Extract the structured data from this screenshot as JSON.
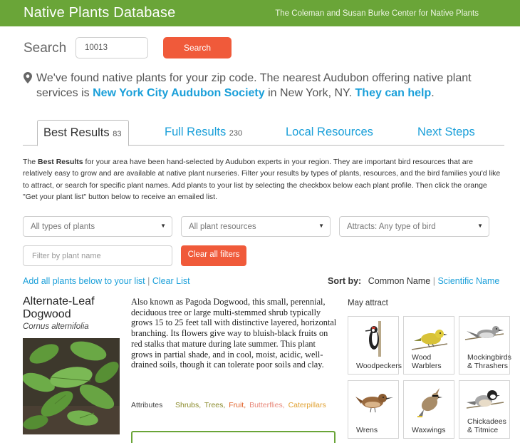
{
  "header": {
    "title": "Native Plants Database",
    "subtitle": "The Coleman and Susan Burke Center for Native Plants"
  },
  "search": {
    "label": "Search",
    "value": "10013",
    "button": "Search"
  },
  "notice": {
    "pre": "We've found native plants for your zip code. The nearest Audubon offering native plant services is ",
    "society": "New York City Audubon Society",
    "mid": " in New York, NY. ",
    "help": "They can help",
    "post": "."
  },
  "tabs": [
    {
      "label": "Best Results",
      "count": "83"
    },
    {
      "label": "Full Results",
      "count": "230"
    },
    {
      "label": "Local Resources",
      "count": ""
    },
    {
      "label": "Next Steps",
      "count": ""
    }
  ],
  "description": {
    "pre": "The ",
    "bold": "Best Results",
    "post": " for your area have been hand-selected by Audubon experts in your region. They are important bird resources that are relatively easy to grow and are available at native plant nurseries. Filter your results by types of plants, resources, and the bird families you'd like to attract, or search for specific plant names. Add plants to your list by selecting the checkbox below each plant profile. Then click the orange \"Get your plant list\" button below to receive an emailed list."
  },
  "filters": {
    "plant_types": "All types of plants",
    "plant_resources": "All plant resources",
    "attracts": "Attracts: Any type of bird",
    "name_placeholder": "Filter by plant name",
    "clear": "Clear all filters"
  },
  "list_actions": {
    "add_all": "Add all plants below to your list",
    "separator": "|",
    "clear": "Clear List"
  },
  "sort": {
    "label": "Sort by:",
    "common": "Common Name",
    "separator": "|",
    "scientific": "Scientific Name"
  },
  "plant": {
    "name": "Alternate-Leaf Dogwood",
    "scientific": "Cornus alternifolia",
    "description": "Also known as Pagoda Dogwood, this small, perennial, deciduous tree or large multi-stemmed shrub typically grows 15 to 25 feet tall with distinctive layered, horizontal branching. Its flowers give way to bluish-black fruits on red stalks that mature during late summer. This plant grows in partial shade, and in cool, moist, acidic, well-drained soils, though it can tolerate poor soils and clay.",
    "attributes_label": "Attributes",
    "attributes": [
      {
        "label": "Shrubs,",
        "color": "#8a8a2a"
      },
      {
        "label": "Trees,",
        "color": "#8a8a2a"
      },
      {
        "label": "Fruit,",
        "color": "#e0622a"
      },
      {
        "label": "Butterflies,",
        "color": "#e8887a"
      },
      {
        "label": "Caterpillars",
        "color": "#e0a030"
      }
    ]
  },
  "attract": {
    "heading": "May attract",
    "birds": [
      {
        "name": "Woodpeckers",
        "icon": "woodpecker-icon"
      },
      {
        "name": "Wood Warblers",
        "icon": "warbler-icon"
      },
      {
        "name": "Mockingbirds & Thrashers",
        "icon": "mockingbird-icon"
      },
      {
        "name": "Wrens",
        "icon": "wren-icon"
      },
      {
        "name": "Waxwings",
        "icon": "waxwing-icon"
      },
      {
        "name": "Chickadees & Titmice",
        "icon": "chickadee-icon"
      }
    ]
  },
  "colors": {
    "brand_green": "#6aa538",
    "accent_orange": "#f05a3a",
    "link_blue": "#1a9fd9"
  }
}
